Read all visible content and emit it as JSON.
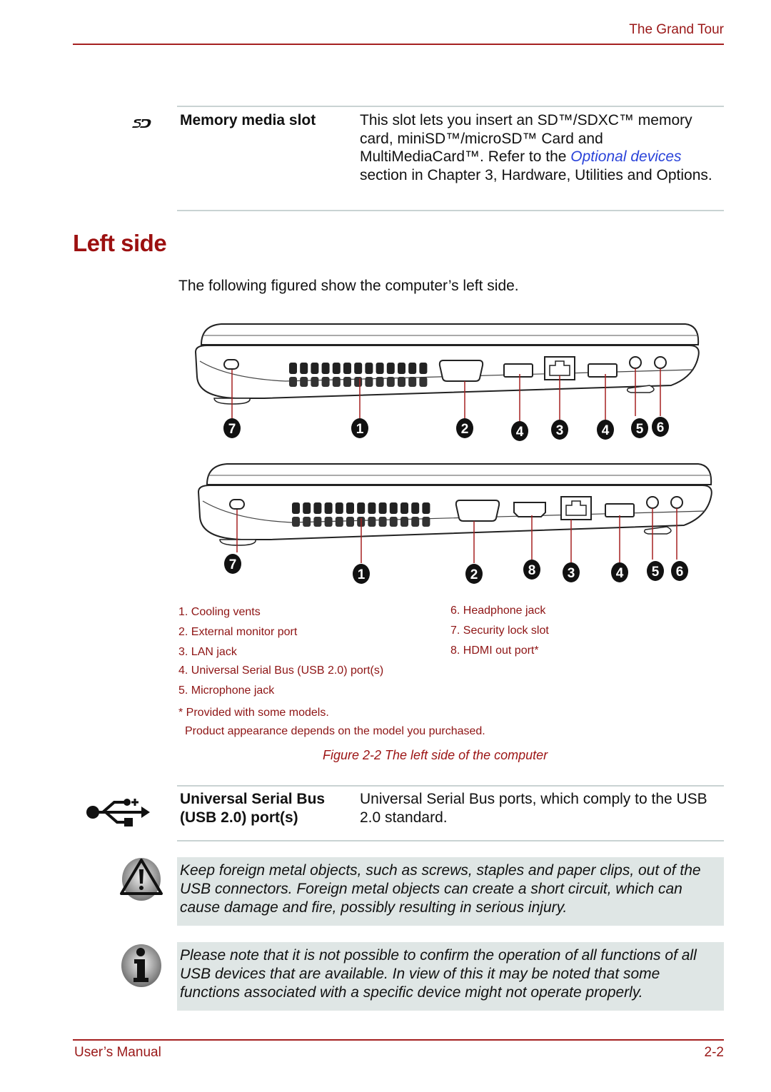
{
  "header": {
    "section_title": "The Grand Tour"
  },
  "memory_slot": {
    "icon": "sd-card-icon",
    "term": "Memory media slot",
    "desc_before_link": "This slot lets you insert an SD™/SDXC™ memory card, miniSD™/microSD™ Card and MultiMediaCard™. Refer to the ",
    "link_text": "Optional devices",
    "desc_after_link": " section in Chapter 3, Hardware, Utilities and Options."
  },
  "section": {
    "heading": "Left side",
    "intro": "The following figured show the computer’s left side."
  },
  "figure": {
    "top_callouts": [
      "7",
      "1",
      "2",
      "4",
      "3",
      "4",
      "5",
      "6"
    ],
    "bottom_callouts": [
      "7",
      "1",
      "2",
      "8",
      "3",
      "4",
      "5",
      "6"
    ],
    "legend_left": [
      "1.  Cooling vents",
      "2.   External monitor port",
      "3.  LAN jack",
      "4.  Universal Serial Bus (USB 2.0) port(s)",
      "5.  Microphone jack"
    ],
    "legend_right": [
      "6. Headphone jack",
      "7. Security lock slot",
      "8. HDMI out port*"
    ],
    "footnote": "* Provided with some models.",
    "appearance_note": "Product appearance depends on the model you purchased.",
    "caption": "Figure 2-2 The left side of the computer"
  },
  "usb": {
    "icon": "usb-icon",
    "term_line1": "Universal Serial Bus",
    "term_line2": "(USB 2.0) port(s)",
    "desc": "Universal Serial Bus ports, which comply to the USB 2.0 standard."
  },
  "warning": {
    "icon": "warning-icon",
    "text": "Keep foreign metal objects, such as screws, staples and paper clips, out of the USB connectors. Foreign metal objects can create a short circuit, which can cause damage and fire, possibly resulting in serious injury."
  },
  "info": {
    "icon": "info-icon",
    "text": "Please note that it is not possible to confirm the operation of all functions of all USB devices that are available. In view of this it may be noted that some functions associated with a specific device might not operate properly."
  },
  "footer": {
    "left": "User’s Manual",
    "page": "2-2"
  },
  "colors": {
    "accent": "#9c1010",
    "link": "#2a43d9",
    "note_bg": "#dfe6e5",
    "rule": "#c9d3d3"
  }
}
